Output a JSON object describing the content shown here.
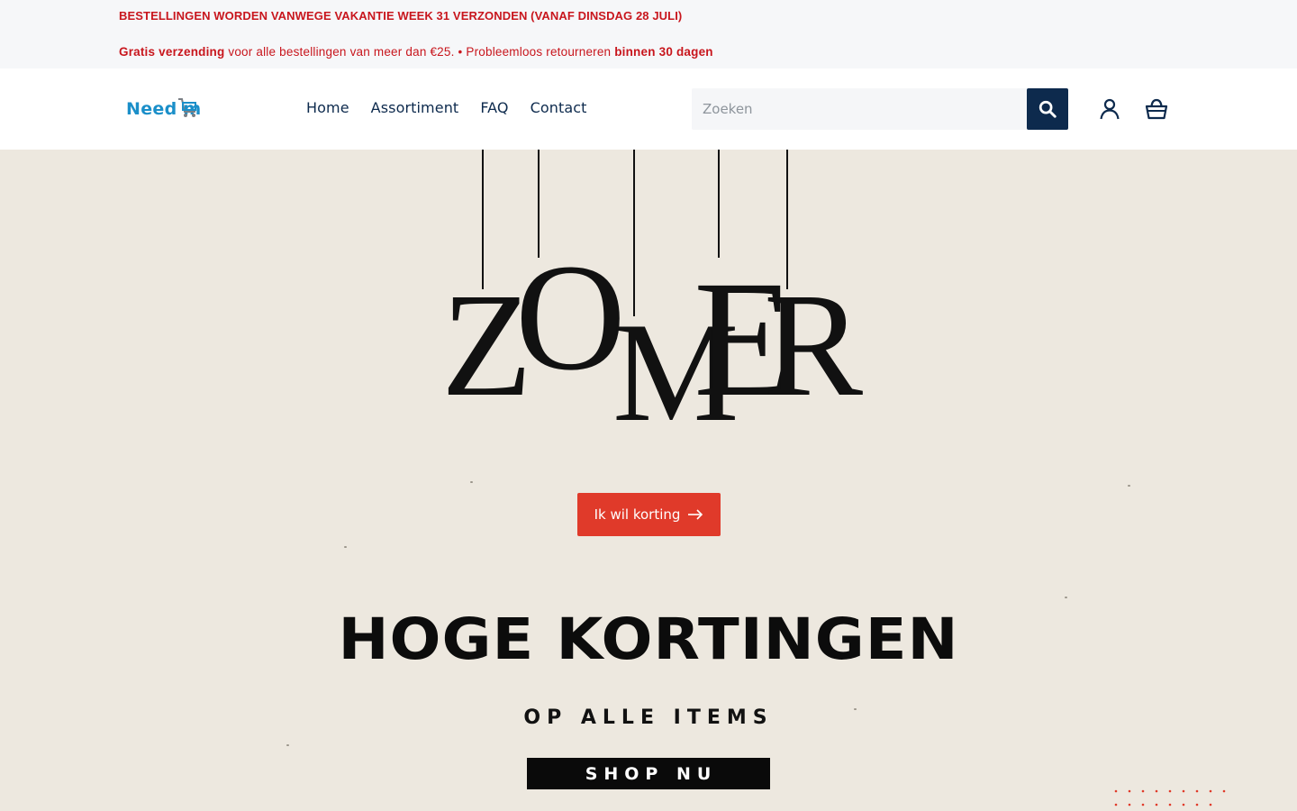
{
  "announcement": {
    "line1": "BESTELLINGEN WORDEN VANWEGE VAKANTIE WEEK 31 VERZONDEN (VANAF DINSDAG 28 JULI)",
    "line2_bold1": "Gratis verzending",
    "line2_text1": " voor alle bestellingen van meer dan €25. • Probleemloos retourneren ",
    "line2_bold2": "binnen 30 dagen"
  },
  "header": {
    "logo_text": "Need  m",
    "nav": [
      {
        "label": "Home"
      },
      {
        "label": "Assortiment"
      },
      {
        "label": "FAQ"
      },
      {
        "label": "Contact"
      }
    ],
    "search": {
      "placeholder": "Zoeken",
      "value": ""
    },
    "icons": {
      "search": "search-icon",
      "account": "user-icon",
      "cart": "basket-icon"
    }
  },
  "hero": {
    "zomer_letters": [
      "Z",
      "O",
      "M",
      "E",
      "R"
    ],
    "cta_label": "Ik wil korting",
    "cta_icon": "arrow-right-icon",
    "headline": "HOGE KORTINGEN",
    "subline": "OP ALLE ITEMS",
    "shop_label": "SHOP NU"
  },
  "colors": {
    "announcement_text": "#c8161d",
    "brand_blue": "#1b8fc9",
    "navy": "#0d2a4d",
    "cta_red": "#e03a2a",
    "hero_bg": "#ede8df"
  }
}
